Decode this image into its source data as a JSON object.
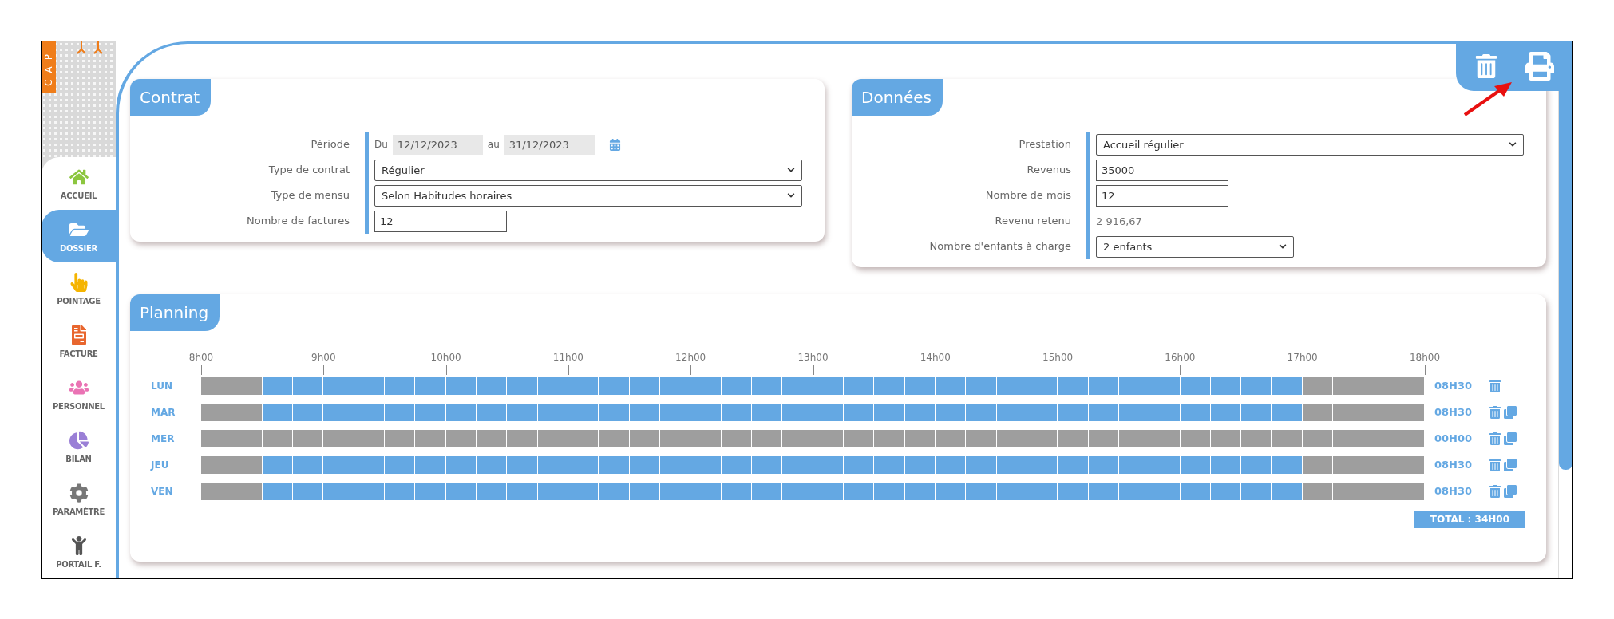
{
  "logo": {
    "text": "CAP"
  },
  "sidebar": {
    "items": [
      {
        "label": "ACCUEIL",
        "kind": "home",
        "selected": false
      },
      {
        "label": "DOSSIER",
        "kind": "folder",
        "selected": true
      },
      {
        "label": "POINTAGE",
        "kind": "pointer",
        "selected": false
      },
      {
        "label": "FACTURE",
        "kind": "invoice",
        "selected": false
      },
      {
        "label": "PERSONNEL",
        "kind": "people",
        "selected": false
      },
      {
        "label": "BILAN",
        "kind": "chart",
        "selected": false
      },
      {
        "label": "PARAMÈTRE",
        "kind": "settings",
        "selected": false
      },
      {
        "label": "PORTAIL F.",
        "kind": "family",
        "selected": false
      }
    ]
  },
  "toolbar": {
    "buttons": [
      {
        "kind": "delete"
      },
      {
        "kind": "print"
      }
    ]
  },
  "contrat": {
    "title": "Contrat",
    "rows": [
      {
        "kind": "period",
        "label": "Période",
        "from_label": "Du",
        "from": "12/12/2023",
        "to_label": "au",
        "to": "31/12/2023"
      },
      {
        "kind": "select",
        "label": "Type de contrat",
        "value": "Régulier"
      },
      {
        "kind": "select",
        "label": "Type de mensu",
        "value": "Selon Habitudes horaires"
      },
      {
        "kind": "input",
        "label": "Nombre de factures",
        "value": "12"
      }
    ]
  },
  "donnees": {
    "title": "Données",
    "rows": [
      {
        "kind": "select",
        "label": "Prestation",
        "value": "Accueil régulier"
      },
      {
        "kind": "input",
        "label": "Revenus",
        "value": "35000"
      },
      {
        "kind": "input",
        "label": "Nombre de mois",
        "value": "12"
      },
      {
        "kind": "text",
        "label": "Revenu retenu",
        "value": "2 916,67"
      },
      {
        "kind": "smallselect",
        "label": "Nombre d'enfants à charge",
        "value": "2 enfants"
      }
    ]
  },
  "planning": {
    "title": "Planning",
    "hours": [
      "8h00",
      "9h00",
      "10h00",
      "11h00",
      "12h00",
      "13h00",
      "14h00",
      "15h00",
      "16h00",
      "17h00",
      "18h00"
    ],
    "days": [
      {
        "label": "LUN",
        "duration": "08H30",
        "copyable": false,
        "slots": [
          false,
          false,
          true,
          true,
          true,
          true,
          true,
          true,
          true,
          true,
          true,
          true,
          true,
          true,
          true,
          true,
          true,
          true,
          true,
          true,
          true,
          true,
          true,
          true,
          true,
          true,
          true,
          true,
          true,
          true,
          true,
          true,
          true,
          true,
          true,
          true,
          false,
          false,
          false,
          false
        ]
      },
      {
        "label": "MAR",
        "duration": "08H30",
        "copyable": true,
        "slots": [
          false,
          false,
          true,
          true,
          true,
          true,
          true,
          true,
          true,
          true,
          true,
          true,
          true,
          true,
          true,
          true,
          true,
          true,
          true,
          true,
          true,
          true,
          true,
          true,
          true,
          true,
          true,
          true,
          true,
          true,
          true,
          true,
          true,
          true,
          true,
          true,
          false,
          false,
          false,
          false
        ]
      },
      {
        "label": "MER",
        "duration": "00H00",
        "copyable": true,
        "slots": [
          false,
          false,
          false,
          false,
          false,
          false,
          false,
          false,
          false,
          false,
          false,
          false,
          false,
          false,
          false,
          false,
          false,
          false,
          false,
          false,
          false,
          false,
          false,
          false,
          false,
          false,
          false,
          false,
          false,
          false,
          false,
          false,
          false,
          false,
          false,
          false,
          false,
          false,
          false,
          false
        ]
      },
      {
        "label": "JEU",
        "duration": "08H30",
        "copyable": true,
        "slots": [
          false,
          false,
          true,
          true,
          true,
          true,
          true,
          true,
          true,
          true,
          true,
          true,
          true,
          true,
          true,
          true,
          true,
          true,
          true,
          true,
          true,
          true,
          true,
          true,
          true,
          true,
          true,
          true,
          true,
          true,
          true,
          true,
          true,
          true,
          true,
          true,
          false,
          false,
          false,
          false
        ]
      },
      {
        "label": "VEN",
        "duration": "08H30",
        "copyable": true,
        "slots": [
          false,
          false,
          true,
          true,
          true,
          true,
          true,
          true,
          true,
          true,
          true,
          true,
          true,
          true,
          true,
          true,
          true,
          true,
          true,
          true,
          true,
          true,
          true,
          true,
          true,
          true,
          true,
          true,
          true,
          true,
          true,
          true,
          true,
          true,
          true,
          true,
          false,
          false,
          false,
          false
        ]
      }
    ],
    "total": "TOTAL : 34H00"
  }
}
